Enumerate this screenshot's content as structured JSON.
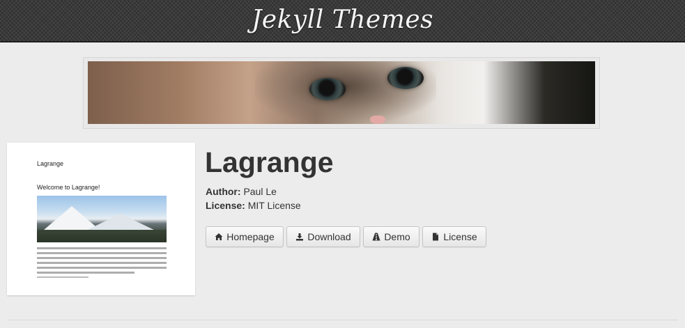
{
  "header": {
    "site_title": "Jekyll Themes"
  },
  "theme": {
    "name": "Lagrange",
    "author_label": "Author:",
    "author": "Paul Le",
    "license_label": "License:",
    "license": "MIT License",
    "buttons": [
      {
        "label": "Homepage",
        "icon": "home-icon"
      },
      {
        "label": "Download",
        "icon": "download-icon"
      },
      {
        "label": "Demo",
        "icon": "road-icon"
      },
      {
        "label": "License",
        "icon": "file-icon"
      }
    ]
  },
  "preview": {
    "title": "Lagrange",
    "heading": "Welcome to Lagrange!"
  },
  "colors": {
    "background": "#ececec",
    "header_bar": "#3a3a3a",
    "title_text": "#333333"
  }
}
